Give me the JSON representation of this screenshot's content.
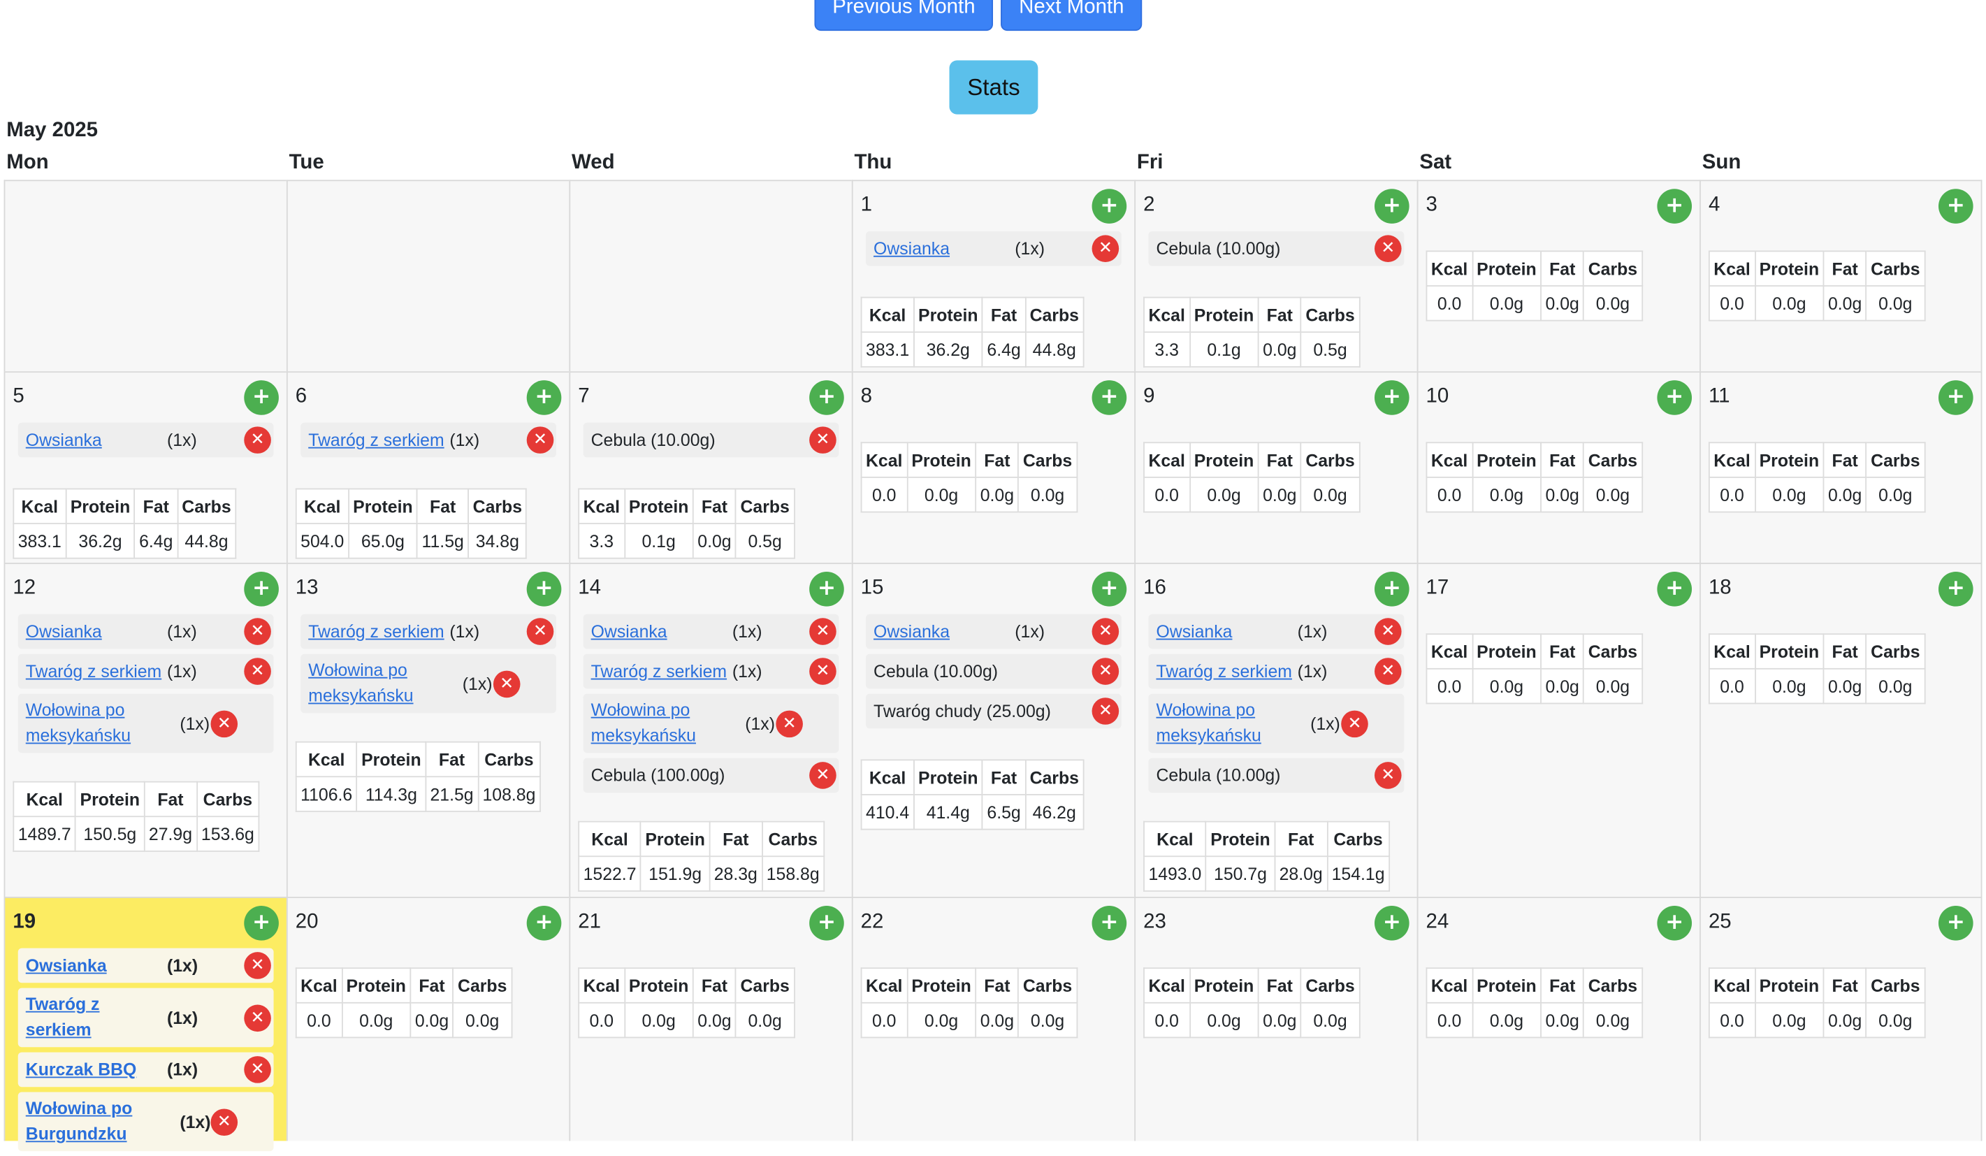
{
  "nav": {
    "prev_label": "Previous Month",
    "next_label": "Next Month",
    "stats_label": "Stats"
  },
  "month_title": "May 2025",
  "weekdays": [
    "Mon",
    "Tue",
    "Wed",
    "Thu",
    "Fri",
    "Sat",
    "Sun"
  ],
  "macro_headers": [
    "Kcal",
    "Protein",
    "Fat",
    "Carbs"
  ],
  "days": [
    {
      "day": "1",
      "col": 4,
      "row": 1,
      "entries": [
        {
          "name": "Owsianka",
          "qty": "(1x)",
          "link": true
        }
      ],
      "totals": [
        "383.1",
        "36.2g",
        "6.4g",
        "44.8g"
      ]
    },
    {
      "day": "2",
      "col": 5,
      "row": 1,
      "entries": [
        {
          "name": "Cebula (10.00g)",
          "qty": "",
          "link": false
        }
      ],
      "totals": [
        "3.3",
        "0.1g",
        "0.0g",
        "0.5g"
      ]
    },
    {
      "day": "3",
      "col": 6,
      "row": 1,
      "entries": [],
      "totals": [
        "0.0",
        "0.0g",
        "0.0g",
        "0.0g"
      ]
    },
    {
      "day": "4",
      "col": 7,
      "row": 1,
      "entries": [],
      "totals": [
        "0.0",
        "0.0g",
        "0.0g",
        "0.0g"
      ]
    },
    {
      "day": "5",
      "col": 1,
      "row": 2,
      "entries": [
        {
          "name": "Owsianka",
          "qty": "(1x)",
          "link": true
        }
      ],
      "totals": [
        "383.1",
        "36.2g",
        "6.4g",
        "44.8g"
      ]
    },
    {
      "day": "6",
      "col": 2,
      "row": 2,
      "entries": [
        {
          "name": "Twaróg z serkiem",
          "qty": "(1x)",
          "link": true
        }
      ],
      "totals": [
        "504.0",
        "65.0g",
        "11.5g",
        "34.8g"
      ]
    },
    {
      "day": "7",
      "col": 3,
      "row": 2,
      "entries": [
        {
          "name": "Cebula (10.00g)",
          "qty": "",
          "link": false
        }
      ],
      "totals": [
        "3.3",
        "0.1g",
        "0.0g",
        "0.5g"
      ]
    },
    {
      "day": "8",
      "col": 4,
      "row": 2,
      "entries": [],
      "totals": [
        "0.0",
        "0.0g",
        "0.0g",
        "0.0g"
      ]
    },
    {
      "day": "9",
      "col": 5,
      "row": 2,
      "entries": [],
      "totals": [
        "0.0",
        "0.0g",
        "0.0g",
        "0.0g"
      ]
    },
    {
      "day": "10",
      "col": 6,
      "row": 2,
      "entries": [],
      "totals": [
        "0.0",
        "0.0g",
        "0.0g",
        "0.0g"
      ]
    },
    {
      "day": "11",
      "col": 7,
      "row": 2,
      "entries": [],
      "totals": [
        "0.0",
        "0.0g",
        "0.0g",
        "0.0g"
      ]
    },
    {
      "day": "12",
      "col": 1,
      "row": 3,
      "entries": [
        {
          "name": "Owsianka",
          "qty": "(1x)",
          "link": true
        },
        {
          "name": "Twaróg z serkiem",
          "qty": "(1x)",
          "link": true
        },
        {
          "name": "Wołowina po meksykańsku",
          "qty": "(1x)",
          "link": true,
          "wrap": true
        }
      ],
      "totals": [
        "1489.7",
        "150.5g",
        "27.9g",
        "153.6g"
      ]
    },
    {
      "day": "13",
      "col": 2,
      "row": 3,
      "entries": [
        {
          "name": "Twaróg z serkiem",
          "qty": "(1x)",
          "link": true
        },
        {
          "name": "Wołowina po meksykańsku",
          "qty": "(1x)",
          "link": true,
          "wrap": true
        }
      ],
      "totals": [
        "1106.6",
        "114.3g",
        "21.5g",
        "108.8g"
      ]
    },
    {
      "day": "14",
      "col": 3,
      "row": 3,
      "entries": [
        {
          "name": "Owsianka",
          "qty": "(1x)",
          "link": true
        },
        {
          "name": "Twaróg z serkiem",
          "qty": "(1x)",
          "link": true
        },
        {
          "name": "Wołowina po meksykańsku",
          "qty": "(1x)",
          "link": true,
          "wrap": true
        },
        {
          "name": "Cebula (100.00g)",
          "qty": "",
          "link": false
        }
      ],
      "totals": [
        "1522.7",
        "151.9g",
        "28.3g",
        "158.8g"
      ]
    },
    {
      "day": "15",
      "col": 4,
      "row": 3,
      "entries": [
        {
          "name": "Owsianka",
          "qty": "(1x)",
          "link": true
        },
        {
          "name": "Cebula (10.00g)",
          "qty": "",
          "link": false
        },
        {
          "name": "Twaróg chudy (25.00g)",
          "qty": "",
          "link": false
        }
      ],
      "totals": [
        "410.4",
        "41.4g",
        "6.5g",
        "46.2g"
      ]
    },
    {
      "day": "16",
      "col": 5,
      "row": 3,
      "entries": [
        {
          "name": "Owsianka",
          "qty": "(1x)",
          "link": true
        },
        {
          "name": "Twaróg z serkiem",
          "qty": "(1x)",
          "link": true
        },
        {
          "name": "Wołowina po meksykańsku",
          "qty": "(1x)",
          "link": true,
          "wrap": true
        },
        {
          "name": "Cebula (10.00g)",
          "qty": "",
          "link": false
        }
      ],
      "totals": [
        "1493.0",
        "150.7g",
        "28.0g",
        "154.1g"
      ]
    },
    {
      "day": "17",
      "col": 6,
      "row": 3,
      "entries": [],
      "totals": [
        "0.0",
        "0.0g",
        "0.0g",
        "0.0g"
      ]
    },
    {
      "day": "18",
      "col": 7,
      "row": 3,
      "entries": [],
      "totals": [
        "0.0",
        "0.0g",
        "0.0g",
        "0.0g"
      ]
    },
    {
      "day": "19",
      "col": 1,
      "row": 4,
      "today": true,
      "entries": [
        {
          "name": "Owsianka",
          "qty": "(1x)",
          "link": true
        },
        {
          "name": "Twaróg z serkiem",
          "qty": "(1x)",
          "link": true
        },
        {
          "name": "Kurczak BBQ",
          "qty": "(1x)",
          "link": true
        },
        {
          "name": "Wołowina po Burgundzku",
          "qty": "(1x)",
          "link": true,
          "wrap": true
        }
      ],
      "totals": null
    },
    {
      "day": "20",
      "col": 2,
      "row": 4,
      "entries": [],
      "totals": [
        "0.0",
        "0.0g",
        "0.0g",
        "0.0g"
      ]
    },
    {
      "day": "21",
      "col": 3,
      "row": 4,
      "entries": [],
      "totals": [
        "0.0",
        "0.0g",
        "0.0g",
        "0.0g"
      ]
    },
    {
      "day": "22",
      "col": 4,
      "row": 4,
      "entries": [],
      "totals": [
        "0.0",
        "0.0g",
        "0.0g",
        "0.0g"
      ]
    },
    {
      "day": "23",
      "col": 5,
      "row": 4,
      "entries": [],
      "totals": [
        "0.0",
        "0.0g",
        "0.0g",
        "0.0g"
      ]
    },
    {
      "day": "24",
      "col": 6,
      "row": 4,
      "entries": [],
      "totals": [
        "0.0",
        "0.0g",
        "0.0g",
        "0.0g"
      ]
    },
    {
      "day": "25",
      "col": 7,
      "row": 4,
      "entries": [],
      "totals": [
        "0.0",
        "0.0g",
        "0.0g",
        "0.0g"
      ]
    }
  ],
  "icons": {
    "add": "plus-icon",
    "remove": "x-icon"
  },
  "colors": {
    "add": "#4caf50",
    "remove": "#e53935",
    "today": "#fcec62",
    "primary": "#3b82f6",
    "stats": "#5bc0eb"
  }
}
